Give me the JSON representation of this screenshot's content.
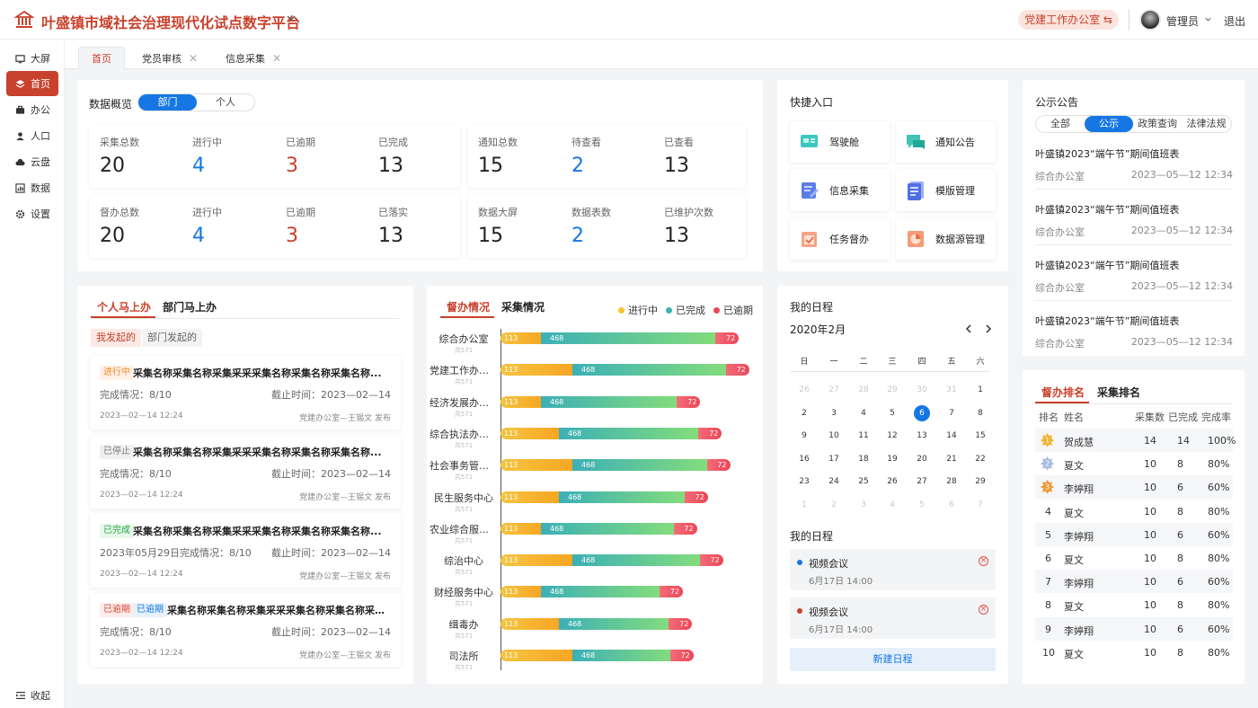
{
  "app": {
    "title": "叶盛镇市域社会治理现代化试点数字平台"
  },
  "topbar": {
    "office_label": "党建工作办公室 ⇆",
    "user_name": "管理员",
    "logout_label": "退出"
  },
  "sidebar": {
    "items": [
      {
        "label": "大屏",
        "icon": "monitor-icon"
      },
      {
        "label": "首页",
        "icon": "layers-icon",
        "active": true
      },
      {
        "label": "办公",
        "icon": "briefcase-icon"
      },
      {
        "label": "人口",
        "icon": "user-icon"
      },
      {
        "label": "云盘",
        "icon": "cloud-icon"
      },
      {
        "label": "数据",
        "icon": "chart-icon"
      },
      {
        "label": "设置",
        "icon": "gear-icon"
      }
    ],
    "collapse_label": "收起"
  },
  "tabs": [
    {
      "label": "首页",
      "active": true,
      "closable": false
    },
    {
      "label": "党员审核",
      "closable": true
    },
    {
      "label": "信息采集",
      "closable": true
    }
  ],
  "overview": {
    "title": "数据概览",
    "toggle": [
      "部门",
      "个人"
    ],
    "group1": [
      {
        "label": "采集总数",
        "value": "20"
      },
      {
        "label": "进行中",
        "value": "4"
      },
      {
        "label": "已逾期",
        "value": "3"
      },
      {
        "label": "已完成",
        "value": "13"
      },
      {
        "label": "督办总数",
        "value": "20"
      },
      {
        "label": "进行中",
        "value": "4"
      },
      {
        "label": "已逾期",
        "value": "3"
      },
      {
        "label": "已落实",
        "value": "13"
      }
    ],
    "group2": [
      {
        "label": "通知总数",
        "value": "15"
      },
      {
        "label": "待查看",
        "value": "2"
      },
      {
        "label": "已查看",
        "value": "13"
      },
      {
        "label": "数据大屏",
        "value": "15"
      },
      {
        "label": "数据表数",
        "value": "2"
      },
      {
        "label": "已维护次数",
        "value": "13"
      }
    ]
  },
  "quick": {
    "title": "快捷入口",
    "items": [
      "驾驶舱",
      "通知公告",
      "信息采集",
      "模版管理",
      "任务督办",
      "数据源管理"
    ]
  },
  "notices": {
    "title": "公示公告",
    "filters": [
      "全部",
      "公示",
      "政策查询",
      "法律法规"
    ],
    "active_filter": 1,
    "items": [
      {
        "title": "叶盛镇2023“端午节”期间值班表",
        "dept": "综合办公室",
        "time": "2023—05—12 12:34"
      },
      {
        "title": "叶盛镇2023“端午节”期间值班表",
        "dept": "综合办公室",
        "time": "2023—05—12 12:34"
      },
      {
        "title": "叶盛镇2023“端午节”期间值班表",
        "dept": "综合办公室",
        "time": "2023—05—12 12:34"
      },
      {
        "title": "叶盛镇2023“端午节”期间值班表",
        "dept": "综合办公室",
        "time": "2023—05—12 12:34"
      }
    ]
  },
  "tasks": {
    "tabs": [
      "个人马上办",
      "部门马上办"
    ],
    "filters": [
      "我发起的",
      "部门发起的"
    ],
    "items": [
      {
        "badges": [
          {
            "text": "进行中",
            "color": "orange"
          }
        ],
        "name": "采集名称采集名称采集采采采集名称采集名称采集名称...",
        "progress": "完成情况：8/10",
        "due": "截止时间：2023—02—14",
        "time": "2023—02—14 12:24",
        "publisher": "党建办公室—王锡文 发布"
      },
      {
        "badges": [
          {
            "text": "已停止",
            "color": "gray"
          }
        ],
        "name": "采集名称采集名称采集采采采集名称采集名称采集名称...",
        "progress": "完成情况：8/10",
        "due": "截止时间：2023—02—14",
        "time": "2023—02—14 12:24",
        "publisher": "党建办公室—王锡文 发布"
      },
      {
        "badges": [
          {
            "text": "已完成",
            "color": "green"
          }
        ],
        "name": "采集名称采集名称采集采采采集名称采集名称采集名称...",
        "progress": "2023年05月29日完成情况：8/10",
        "due": "截止时间：2023—02—14",
        "time": "2023—02—14 12:24",
        "publisher": "党建办公室—王锡文 发布"
      },
      {
        "badges": [
          {
            "text": "已逾期",
            "color": "red"
          },
          {
            "text": "已逾期",
            "color": "blue"
          }
        ],
        "name": "采集名称采集名称采集采采采集名称采集名称采集名称...",
        "progress": "完成情况：8/10",
        "due": "截止时间：2023—02—14",
        "time": "2023—02—14 12:24",
        "publisher": "党建办公室—王锡文 发布"
      }
    ]
  },
  "supervision": {
    "tabs": [
      "督办情况",
      "采集情况"
    ],
    "legend_colors": [
      "#f8c42f",
      "#3cb3b1",
      "#ec4a5b"
    ]
  },
  "chart_data": {
    "type": "bar",
    "stacked": true,
    "orientation": "horizontal",
    "categories": [
      "综合办公室",
      "党建工作办公室",
      "经济发展办公室",
      "综合执法办公室",
      "社会事务管理...",
      "民生服务中心",
      "农业综合服务...",
      "综治中心",
      "财经服务中心",
      "缉毒办",
      "司法所"
    ],
    "category_sublabel": "共571",
    "series": [
      {
        "name": "进行中",
        "values": [
          113,
          113,
          113,
          113,
          113,
          113,
          113,
          113,
          113,
          113,
          113
        ]
      },
      {
        "name": "已完成",
        "values": [
          468,
          468,
          468,
          468,
          468,
          468,
          468,
          468,
          468,
          468,
          468
        ]
      },
      {
        "name": "已逾期",
        "values": [
          72,
          72,
          72,
          72,
          72,
          72,
          72,
          72,
          72,
          72,
          72
        ]
      }
    ],
    "legend": "top-right"
  },
  "calendar": {
    "title": "我的日程",
    "month": "2020年2月",
    "weekdays": [
      "日",
      "一",
      "二",
      "三",
      "四",
      "五",
      "六"
    ],
    "rows": [
      [
        {
          "d": "26",
          "dim": true
        },
        {
          "d": "27",
          "dim": true
        },
        {
          "d": "28",
          "dim": true
        },
        {
          "d": "29",
          "dim": true
        },
        {
          "d": "30",
          "dim": true
        },
        {
          "d": "31",
          "dim": true
        },
        {
          "d": "1"
        }
      ],
      [
        {
          "d": "2"
        },
        {
          "d": "3"
        },
        {
          "d": "4"
        },
        {
          "d": "5"
        },
        {
          "d": "6",
          "today": true
        },
        {
          "d": "7"
        },
        {
          "d": "8"
        }
      ],
      [
        {
          "d": "9"
        },
        {
          "d": "10"
        },
        {
          "d": "11"
        },
        {
          "d": "12"
        },
        {
          "d": "13"
        },
        {
          "d": "14"
        },
        {
          "d": "15"
        }
      ],
      [
        {
          "d": "16"
        },
        {
          "d": "17"
        },
        {
          "d": "18"
        },
        {
          "d": "19"
        },
        {
          "d": "20"
        },
        {
          "d": "21"
        },
        {
          "d": "22"
        }
      ],
      [
        {
          "d": "23"
        },
        {
          "d": "24"
        },
        {
          "d": "25"
        },
        {
          "d": "26"
        },
        {
          "d": "27"
        },
        {
          "d": "28"
        },
        {
          "d": "29"
        }
      ],
      [
        {
          "d": "1",
          "dim": true
        },
        {
          "d": "2",
          "dim": true
        },
        {
          "d": "3",
          "dim": true
        },
        {
          "d": "4",
          "dim": true
        },
        {
          "d": "5",
          "dim": true
        },
        {
          "d": "6",
          "dim": true
        },
        {
          "d": "7",
          "dim": true
        }
      ]
    ],
    "schedule_title": "我的日程",
    "schedule": [
      {
        "title": "视频会议",
        "time": "6月17日 14:00",
        "dot": "#1677e4"
      },
      {
        "title": "视频会议",
        "time": "6月17日 14:00",
        "dot": "#c8412c"
      }
    ],
    "new_label": "新建日程"
  },
  "ranking": {
    "tabs": [
      "督办排名",
      "采集排名"
    ],
    "headers": [
      "排名",
      "姓名",
      "采集数",
      "已完成",
      "完成率"
    ],
    "rows": [
      {
        "rank": "1",
        "name": "贺成慧",
        "count": "14",
        "done": "14",
        "rate": "100%"
      },
      {
        "rank": "2",
        "name": "夏文",
        "count": "10",
        "done": "8",
        "rate": "80%"
      },
      {
        "rank": "3",
        "name": "李婷翔",
        "count": "10",
        "done": "6",
        "rate": "60%"
      },
      {
        "rank": "4",
        "name": "夏文",
        "count": "10",
        "done": "8",
        "rate": "80%"
      },
      {
        "rank": "5",
        "name": "李婷翔",
        "count": "10",
        "done": "6",
        "rate": "60%"
      },
      {
        "rank": "6",
        "name": "夏文",
        "count": "10",
        "done": "8",
        "rate": "80%"
      },
      {
        "rank": "7",
        "name": "李婷翔",
        "count": "10",
        "done": "6",
        "rate": "60%"
      },
      {
        "rank": "8",
        "name": "夏文",
        "count": "10",
        "done": "8",
        "rate": "80%"
      },
      {
        "rank": "9",
        "name": "李婷翔",
        "count": "10",
        "done": "6",
        "rate": "60%"
      },
      {
        "rank": "10",
        "name": "夏文",
        "count": "10",
        "done": "8",
        "rate": "80%"
      }
    ]
  }
}
